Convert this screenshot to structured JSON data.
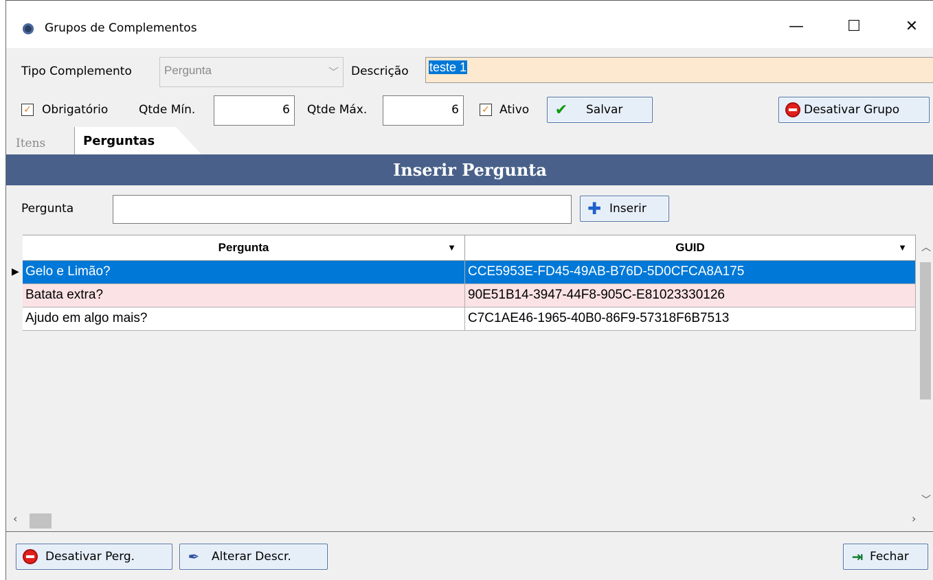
{
  "window": {
    "title": "Grupos de Complementos",
    "minimize": "—",
    "maximize": "☐",
    "close": "✕"
  },
  "form": {
    "tipo_label": "Tipo Complemento",
    "tipo_value": "Pergunta",
    "descricao_label": "Descrição",
    "descricao_value": "teste 1",
    "obrigatorio_label": "Obrigatório",
    "obrigatorio_checked": true,
    "qtde_min_label": "Qtde Mín.",
    "qtde_min_value": "6",
    "qtde_max_label": "Qtde Máx.",
    "qtde_max_value": "6",
    "ativo_label": "Ativo",
    "ativo_checked": true,
    "salvar_label": "Salvar",
    "desativar_grupo_label": "Desativar Grupo"
  },
  "tabs": [
    {
      "label": "Itens",
      "active": false
    },
    {
      "label": "Perguntas",
      "active": true
    }
  ],
  "section": {
    "title": "Inserir Pergunta",
    "pergunta_label": "Pergunta",
    "pergunta_value": "",
    "inserir_label": "Inserir"
  },
  "grid": {
    "columns": [
      "Pergunta",
      "GUID"
    ],
    "rows": [
      {
        "pergunta": "Gelo e Limão?",
        "guid": "CCE5953E-FD45-49AB-B76D-5D0CFCA8A175",
        "selected": true
      },
      {
        "pergunta": "Batata extra?",
        "guid": "90E51B14-3947-44F8-905C-E81023330126",
        "selected": false
      },
      {
        "pergunta": "Ajudo em algo mais?",
        "guid": "C7C1AE46-1965-40B0-86F9-57318F6B7513",
        "selected": false
      }
    ]
  },
  "footer": {
    "desativar_perg_label": "Desativar Perg.",
    "alterar_descr_label": "Alterar Descr.",
    "fechar_label": "Fechar"
  },
  "colors": {
    "section_header": "#49618a",
    "selected_row": "#0078d7",
    "alt_row": "#fbe2e4",
    "descricao_bg": "#fde9d0"
  }
}
